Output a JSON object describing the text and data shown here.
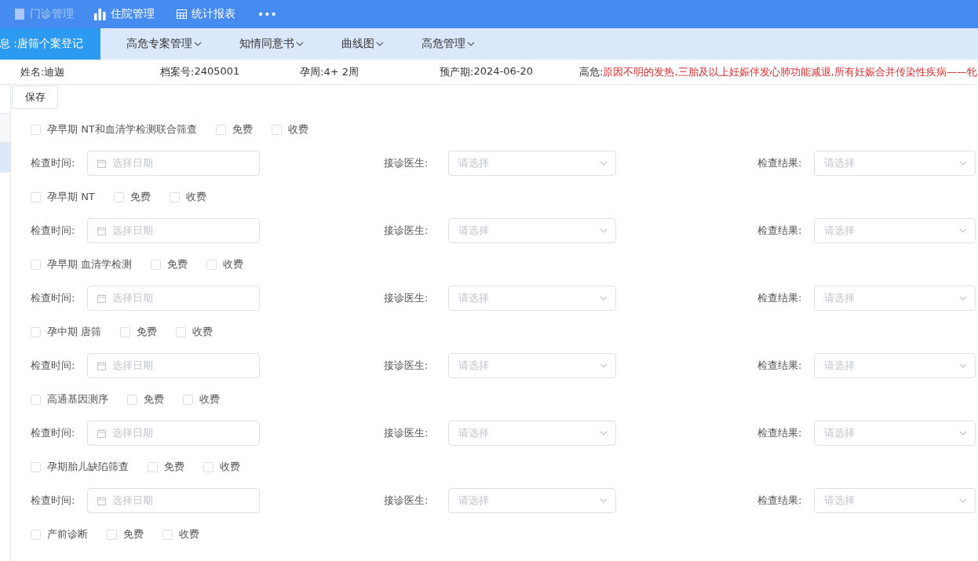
{
  "top_nav": [
    {
      "label": "门诊管理",
      "disabled": true
    },
    {
      "label": "住院管理",
      "disabled": false
    },
    {
      "label": "统计报表",
      "disabled": false
    },
    {
      "label": "•••",
      "disabled": false
    }
  ],
  "tabs": [
    {
      "label": "息 :唐筛个案登记",
      "selected": true
    },
    {
      "label": "高危专案管理",
      "selected": false
    },
    {
      "label": "知情同意书",
      "selected": false
    },
    {
      "label": "曲线图",
      "selected": false
    },
    {
      "label": "高危管理",
      "selected": false
    }
  ],
  "patient": {
    "name_label": "姓名:",
    "name": "迪迦",
    "file_label": "档案号:",
    "file_no": "2405001",
    "week_label": "孕周:",
    "week": "4+ 2周",
    "due_label": "预产期:",
    "due": "2024-06-20",
    "risk_label": "高危:",
    "risk": "原因不明的发热,三胎及以上妊娠伴发心肺功能减退,所有妊娠合并传染性疾病——牝"
  },
  "sidebar": {
    "items": [
      {
        "selected": false
      },
      {
        "selected": true
      }
    ]
  },
  "save_button": "保存",
  "groups": [
    {
      "title": "孕早期 NT和血清学检测联合筛查",
      "checked": false,
      "options": [
        {
          "label": "免费",
          "checked": false
        },
        {
          "label": "收费",
          "checked": false
        }
      ],
      "fields": {
        "time_label": "检查时间:",
        "time_placeholder": "选择日期",
        "doctor_label": "接诊医生:",
        "doctor_placeholder": "请选择",
        "result_label": "检查结果:",
        "result_placeholder": "请选择"
      }
    },
    {
      "title": "孕早期 NT",
      "checked": false,
      "options": [
        {
          "label": "免费",
          "checked": false
        },
        {
          "label": "收费",
          "checked": false
        }
      ],
      "fields": {
        "time_label": "检查时间:",
        "time_placeholder": "选择日期",
        "doctor_label": "接诊医生:",
        "doctor_placeholder": "请选择",
        "result_label": "检查结果:",
        "result_placeholder": "请选择"
      }
    },
    {
      "title": "孕早期 血清学检测",
      "checked": false,
      "options": [
        {
          "label": "免费",
          "checked": false
        },
        {
          "label": "收费",
          "checked": false
        }
      ],
      "fields": {
        "time_label": "检查时间:",
        "time_placeholder": "选择日期",
        "doctor_label": "接诊医生:",
        "doctor_placeholder": "请选择",
        "result_label": "检查结果:",
        "result_placeholder": "请选择"
      }
    },
    {
      "title": "孕中期 唐筛",
      "checked": false,
      "options": [
        {
          "label": "免费",
          "checked": false
        },
        {
          "label": "收费",
          "checked": false
        }
      ],
      "fields": {
        "time_label": "检查时间:",
        "time_placeholder": "选择日期",
        "doctor_label": "接诊医生:",
        "doctor_placeholder": "请选择",
        "result_label": "检查结果:",
        "result_placeholder": "请选择"
      }
    },
    {
      "title": "高通基因测序",
      "checked": false,
      "options": [
        {
          "label": "免费",
          "checked": false
        },
        {
          "label": "收费",
          "checked": false
        }
      ],
      "fields": {
        "time_label": "检查时间:",
        "time_placeholder": "选择日期",
        "doctor_label": "接诊医生:",
        "doctor_placeholder": "请选择",
        "result_label": "检查结果:",
        "result_placeholder": "请选择"
      }
    },
    {
      "title": "孕期胎儿缺陷筛查",
      "checked": false,
      "options": [
        {
          "label": "免费",
          "checked": false
        },
        {
          "label": "收费",
          "checked": false
        }
      ],
      "fields": {
        "time_label": "检查时间:",
        "time_placeholder": "选择日期",
        "doctor_label": "接诊医生:",
        "doctor_placeholder": "请选择",
        "result_label": "检查结果:",
        "result_placeholder": "请选择"
      }
    },
    {
      "title": "产前诊断",
      "checked": false,
      "options": [
        {
          "label": "免费",
          "checked": false
        },
        {
          "label": "收费",
          "checked": false
        }
      ]
    }
  ]
}
